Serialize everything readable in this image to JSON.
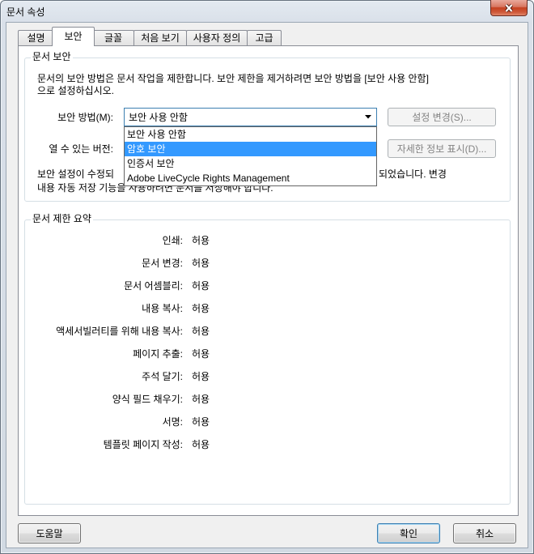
{
  "window": {
    "title": "문서 속성"
  },
  "icons": {
    "close": "close-icon",
    "dropdown_arrow": "chevron-down-icon"
  },
  "colors": {
    "selection_highlight": "#3399ff",
    "focus_border": "#3c7fb1",
    "close_button": "#c4401f",
    "disabled_text": "#838383",
    "tab_border": "#898c95",
    "groupbox_border": "#d5dfe5",
    "dialog_background": "#f0f0f0"
  },
  "tabs": [
    {
      "label": "설명",
      "active": false
    },
    {
      "label": "보안",
      "active": true
    },
    {
      "label": "글꼴",
      "active": false
    },
    {
      "label": "처음 보기",
      "active": false
    },
    {
      "label": "사용자 정의",
      "active": false
    },
    {
      "label": "고급",
      "active": false
    }
  ],
  "security": {
    "group_title": "문서 보안",
    "description": [
      "문서의 보안 방법은 문서 작업을 제한합니다. 보안 제한을 제거하려면 보안 방법을 [보안 사용 안함]",
      "으로 설정하십시오."
    ],
    "method_label": "보안 방법(M):",
    "method_selected": "보안 사용 안함",
    "change_settings_label": "설정 변경(S)...",
    "change_settings_enabled": false,
    "compat_label": "열 수 있는 버전:",
    "show_details_label": "자세한 정보 표시(D)...",
    "show_details_enabled": false,
    "notice": {
      "line1_visible_start": "보안 설정이 수정되",
      "line1_visible_end": "되었습니다. 변경",
      "line2": "내용 자동 저장 기능을 사용하려면 문서를 저장해야 합니다."
    }
  },
  "method_dropdown": {
    "open": true,
    "highlighted_index": 1,
    "options": [
      "보안 사용 안함",
      "암호 보안",
      "인증서 보안",
      "Adobe LiveCycle Rights Management"
    ]
  },
  "restrictions": {
    "group_title": "문서 제한 요약",
    "rows": [
      {
        "label": "인쇄:",
        "value": "허용"
      },
      {
        "label": "문서 변경:",
        "value": "허용"
      },
      {
        "label": "문서 어셈블리:",
        "value": "허용"
      },
      {
        "label": "내용 복사:",
        "value": "허용"
      },
      {
        "label": "액세서빌러티를 위해 내용 복사:",
        "value": "허용"
      },
      {
        "label": "페이지 추출:",
        "value": "허용"
      },
      {
        "label": "주석 달기:",
        "value": "허용"
      },
      {
        "label": "양식 필드 채우기:",
        "value": "허용"
      },
      {
        "label": "서명:",
        "value": "허용"
      },
      {
        "label": "템플릿 페이지 작성:",
        "value": "허용"
      }
    ]
  },
  "footer": {
    "help_label": "도움말",
    "ok_label": "확인",
    "cancel_label": "취소"
  }
}
